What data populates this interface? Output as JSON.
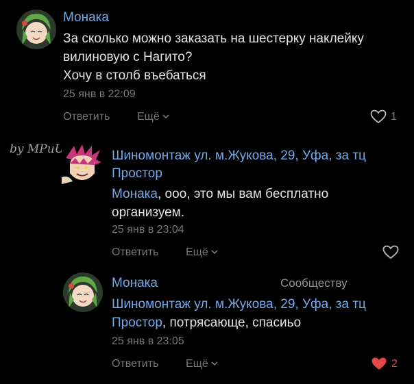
{
  "comments": [
    {
      "author": "Монака",
      "lines": [
        "За сколько можно заказать на шестерку наклейку",
        "вилиновую с Нагито?",
        "Хочу в столб въебаться"
      ],
      "time": "25 янв в 22:09",
      "reply_label": "Ответить",
      "more_label": "Ещё",
      "likes": "1",
      "liked": false
    },
    {
      "author_line1": "Шиномонтаж ул. м.Жукова, 29, Уфа, за тц",
      "author_line2": "Простор",
      "mention": "Монака",
      "text_after_mention": ", ооо, это мы вам бесплатно",
      "text_line2": "организуем.",
      "time": "25 янв в 23:04",
      "reply_label": "Ответить",
      "more_label": "Ещё",
      "likes": "",
      "liked": false
    },
    {
      "author": "Монака",
      "badge": "Сообществу",
      "mention_line1": "Шиномонтаж ул. м.Жукова, 29, Уфа, за тц",
      "mention_line2": "Простор",
      "text_after_mention": ", потрясающе, спасиьо",
      "time": "25 янв в 23:05",
      "reply_label": "Ответить",
      "more_label": "Ещё",
      "likes": "2",
      "liked": true
    }
  ],
  "watermark": "by MPuUTA",
  "colors": {
    "background": "#000000",
    "link": "#71aaeb",
    "muted": "#76787a",
    "like_active": "#e64646"
  },
  "icons": [
    "heart-icon",
    "chevron-down-icon"
  ]
}
